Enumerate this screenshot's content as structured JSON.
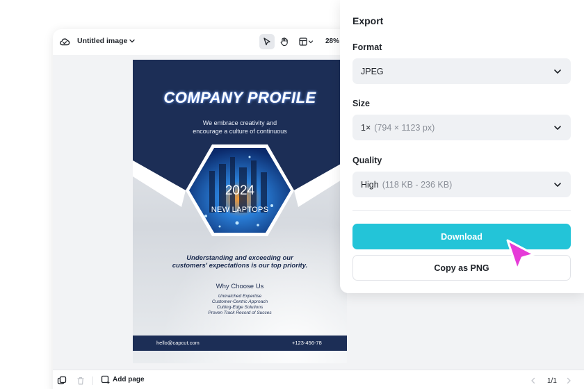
{
  "editor": {
    "title": "Untitled image",
    "zoom": "28%",
    "add_page_label": "Add page",
    "page_indicator": "1/1"
  },
  "document": {
    "title": "COMPANY PROFILE",
    "subtitle_lines": [
      "We embrace creativity and",
      "encourage a culture of continuous"
    ],
    "year": "2024",
    "product": "NEW LAPTOPS",
    "quote_lines": [
      "Understanding and exceeding our",
      "customers' expectations is our top priority."
    ],
    "why_heading": "Why Choose Us",
    "why_items": [
      "Unmatched Expertise",
      "Customer-Centric Approach",
      "Cutting-Edge Solutions",
      "Proven Track Record of Succes"
    ],
    "email": "hello@capcut.com",
    "phone": "+123-456-78"
  },
  "export_panel": {
    "title": "Export",
    "format_label": "Format",
    "format_value": "JPEG",
    "size_label": "Size",
    "size_value": "1×",
    "size_hint": "(794 × 1123 px)",
    "quality_label": "Quality",
    "quality_value": "High",
    "quality_hint": "(118 KB - 236 KB)",
    "download_label": "Download",
    "copy_label": "Copy as PNG"
  },
  "colors": {
    "accent": "#23c4d8",
    "pointer": "#e63bd8",
    "doc_navy": "#1c2e56"
  },
  "icons": [
    "cloud-icon",
    "chevron-down-icon",
    "select-pointer-icon",
    "hand-icon",
    "layout-icon",
    "layers-icon",
    "trash-icon",
    "add-page-icon",
    "chevron-left-icon",
    "chevron-right-icon",
    "cursor-pointer-icon"
  ]
}
